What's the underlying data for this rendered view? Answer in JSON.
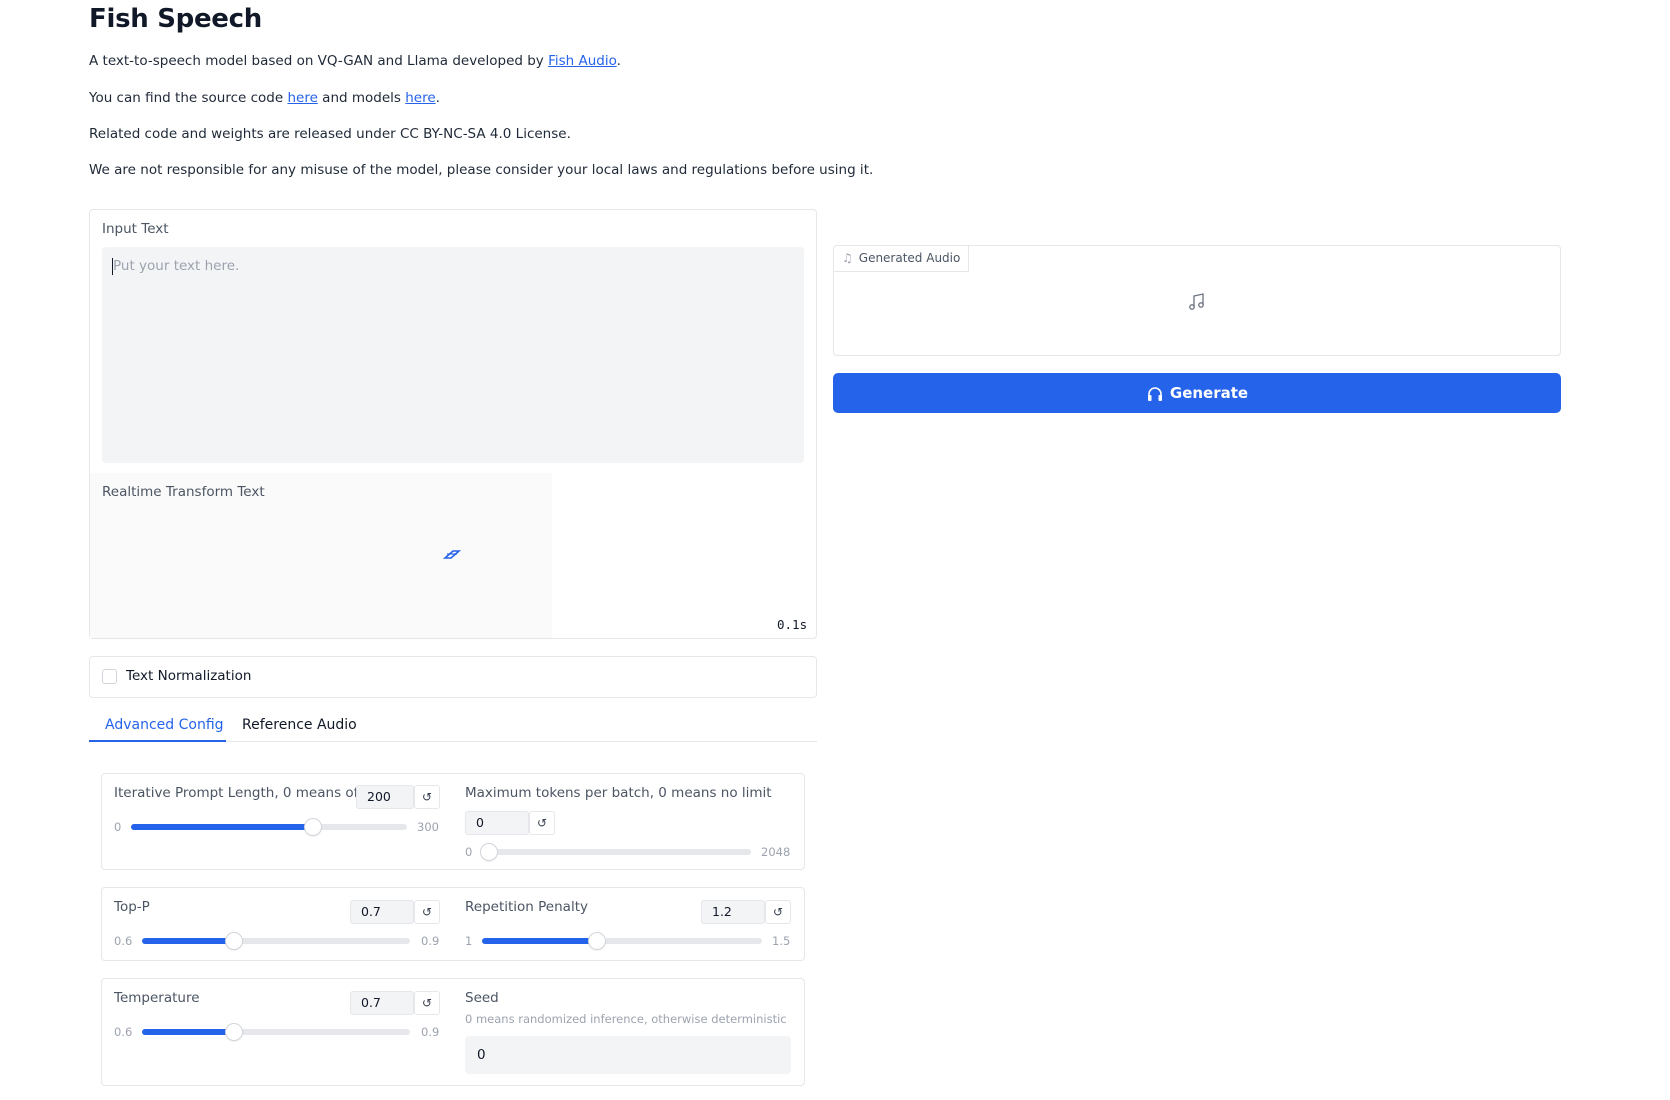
{
  "header": {
    "title": "Fish Speech",
    "line1_prefix": "A text-to-speech model based on VQ-GAN and Llama developed by ",
    "line1_link": "Fish Audio",
    "line1_suffix": ".",
    "line2_prefix": "You can find the source code ",
    "line2_link1": "here",
    "line2_middle": " and models ",
    "line2_link2": "here",
    "line2_suffix": ".",
    "line3": "Related code and weights are released under CC BY-NC-SA 4.0 License.",
    "line4": "We are not responsible for any misuse of the model, please consider your local laws and regulations before using it."
  },
  "input": {
    "label": "Input Text",
    "placeholder": "Put your text here."
  },
  "realtime": {
    "label": "Realtime Transform Text",
    "timer": "0.1s"
  },
  "normalization": {
    "label": "Text Normalization",
    "checked": false
  },
  "tabs": [
    {
      "label": "Advanced Config",
      "active": true
    },
    {
      "label": "Reference Audio",
      "active": false
    }
  ],
  "sliders": {
    "prompt_length": {
      "label": "Iterative Prompt Length, 0 means off",
      "value": "200",
      "min": "0",
      "max": "300",
      "fraction": 0.667
    },
    "max_tokens": {
      "label": "Maximum tokens per batch, 0 means no limit",
      "value": "0",
      "min": "0",
      "max": "2048",
      "fraction": 0.0
    },
    "top_p": {
      "label": "Top-P",
      "value": "0.7",
      "min": "0.6",
      "max": "0.9",
      "fraction": 0.333
    },
    "repetition_penalty": {
      "label": "Repetition Penalty",
      "value": "1.2",
      "min": "1",
      "max": "1.5",
      "fraction": 0.4
    },
    "temperature": {
      "label": "Temperature",
      "value": "0.7",
      "min": "0.6",
      "max": "0.9",
      "fraction": 0.333
    }
  },
  "seed": {
    "label": "Seed",
    "hint": "0 means randomized inference, otherwise deterministic",
    "value": "0"
  },
  "output": {
    "audio_label": "Generated Audio",
    "generate_label": "Generate"
  },
  "colors": {
    "accent": "#2563eb"
  },
  "icons": {
    "reset": "reset-icon",
    "music": "music-note-icon",
    "headphones": "headphones-icon",
    "loader": "loading-icon"
  }
}
